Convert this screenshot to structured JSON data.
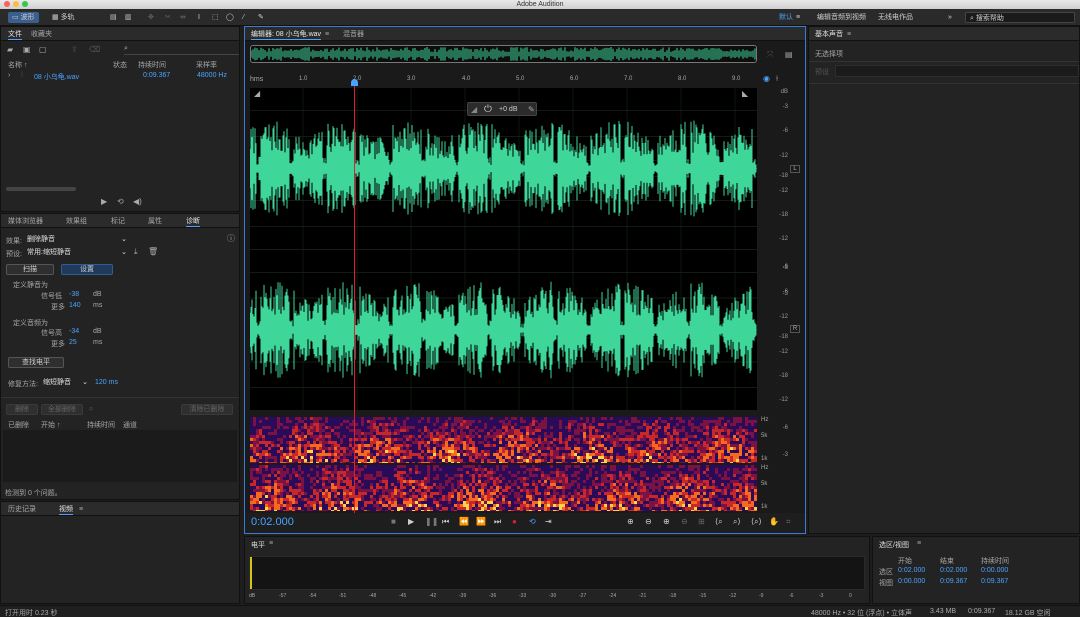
{
  "app": {
    "window_title": "Adobe Audition"
  },
  "toolbar": {
    "waveform_label": "波形",
    "multitrack_label": "多轨",
    "workspace_default": "默认",
    "workspace_edit_video": "编辑音频到视频",
    "workspace_wireless": "无线电作品",
    "search_help_placeholder": "搜索帮助"
  },
  "files_panel": {
    "tabs": [
      "文件",
      "收藏夹"
    ],
    "columns": [
      "名称 ↑",
      "状态",
      "持续时间",
      "采样率"
    ],
    "file": {
      "name": "08 小乌龟.wav",
      "duration": "0:09.367",
      "sample_rate": "48000 Hz"
    }
  },
  "effects_panel": {
    "tabs": [
      "媒体浏览器",
      "效果组",
      "标记",
      "属性",
      "诊断"
    ],
    "effect_label": "效果:",
    "effect_value": "删除静音",
    "preset_label": "预设:",
    "preset_value": "常用:缩短静音",
    "scan_button": "扫描",
    "settings_button": "设置",
    "define_silence": "定义静音为",
    "silence_signal_label": "信号低",
    "silence_signal_value": "-38",
    "silence_more_label": "更多",
    "silence_more_value": "140",
    "define_audio": "定义音频为",
    "audio_signal_label": "信号高",
    "audio_signal_value": "-34",
    "audio_more_label": "更多",
    "audio_more_value": "25",
    "unit_db": "dB",
    "unit_ms": "ms",
    "find_level_button": "查找电平",
    "repair_label": "修复方法:",
    "repair_value": "缩短静音",
    "repair_ms": "120 ms",
    "delete_button": "删除",
    "delete_all_button": "全部删除",
    "clear_deleted_button": "清除已删除",
    "result_columns": [
      "已删除",
      "开始 ↑",
      "持续时间",
      "通道"
    ],
    "detected_text": "检测到 0 个问题。"
  },
  "history_panel": {
    "tabs": [
      "历史记录",
      "视频"
    ]
  },
  "editor": {
    "tab_title": "编辑器: 08 小乌龟.wav",
    "mixer_tab": "混音器",
    "ruler_unit": "hms",
    "ruler_ticks": [
      "1.0",
      "2.0",
      "3.0",
      "4.0",
      "5.0",
      "6.0",
      "7.0",
      "8.0",
      "9.0"
    ],
    "hud_gain": "+0 dB",
    "db_ticks": [
      "dB",
      "-3",
      "-6",
      "-12",
      "-18",
      "-12",
      "-18",
      "-12",
      "-6",
      "-3"
    ],
    "channel_left": "L",
    "channel_right": "R",
    "spec_ticks": [
      "Hz",
      "5k",
      "1k"
    ],
    "current_time": "0:02.000",
    "playhead_fraction": 0.205
  },
  "essential_sound": {
    "title": "基本声音",
    "no_selection": "无选择项",
    "preset_label": "预设"
  },
  "levels_panel": {
    "title": "电平",
    "scale": [
      "dB",
      "-57",
      "-54",
      "-51",
      "-48",
      "-45",
      "-42",
      "-39",
      "-36",
      "-33",
      "-30",
      "-27",
      "-24",
      "-21",
      "-18",
      "-15",
      "-12",
      "-9",
      "-6",
      "-3",
      "0"
    ]
  },
  "selection_panel": {
    "title": "选区/视图",
    "columns": [
      "开始",
      "结束",
      "持续时间"
    ],
    "selection_label": "选区",
    "selection": [
      "0:02.000",
      "0:02.000",
      "0:00.000"
    ],
    "view_label": "视图",
    "view": [
      "0:00.000",
      "0:09.367",
      "0:09.367"
    ]
  },
  "status_bar": {
    "left": "打开用时 0.23 秒",
    "sample_info": "48000 Hz • 32 位 (浮点) • 立体声",
    "size": "3.43 MB",
    "duration": "0:09.367",
    "free": "18.12 GB 空闲"
  },
  "colors": {
    "waveform": "#3fd69a",
    "accent": "#4aa3ff",
    "playhead": "#e0202a",
    "record": "#e0202a"
  }
}
